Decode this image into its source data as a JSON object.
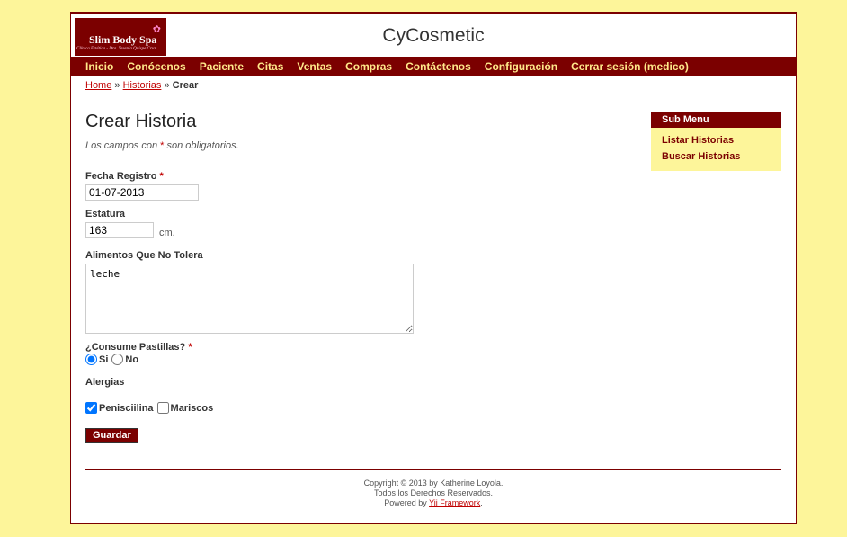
{
  "header": {
    "logo_title": "Slim Body Spa",
    "logo_subtitle": "Clínica Estética - Dra. Yesenia Quispe Cruz",
    "site_title": "CyCosmetic"
  },
  "menu": {
    "items": [
      "Inicio",
      "Conócenos",
      "Paciente",
      "Citas",
      "Ventas",
      "Compras",
      "Contáctenos",
      "Configuración",
      "Cerrar sesión (medico)"
    ]
  },
  "breadcrumbs": {
    "home": "Home",
    "sep": "»",
    "historias": "Historias",
    "current": "Crear"
  },
  "form": {
    "heading": "Crear Historia",
    "note_before": "Los campos con",
    "required_mark": "*",
    "note_after": "son obligatorios.",
    "fecha_label": "Fecha Registro",
    "fecha_value": "01-07-2013",
    "estatura_label": "Estatura",
    "estatura_value": "163",
    "estatura_unit": "cm.",
    "alimentos_label": "Alimentos Que No Tolera",
    "alimentos_value": "leche",
    "pastillas_label": "¿Consume Pastillas?",
    "pastillas_options": [
      "Si",
      "No"
    ],
    "pastillas_selected": "Si",
    "alergias_label": "Alergias",
    "alergias_options": [
      {
        "label": "Penisciilina",
        "checked": true
      },
      {
        "label": "Mariscos",
        "checked": false
      }
    ],
    "submit_label": "Guardar"
  },
  "sidebar": {
    "title": "Sub Menu",
    "items": [
      "Listar Historias",
      "Buscar Historias"
    ]
  },
  "footer": {
    "line1": "Copyright © 2013 by Katherine Loyola.",
    "line2": "Todos los Derechos Reservados.",
    "powered_prefix": "Powered by",
    "powered_link": "Yii Framework",
    "powered_suffix": "."
  },
  "colors": {
    "accent": "#7b0000",
    "background": "#fdf59a",
    "menu_text": "#ffe88a",
    "link": "#c00000"
  }
}
